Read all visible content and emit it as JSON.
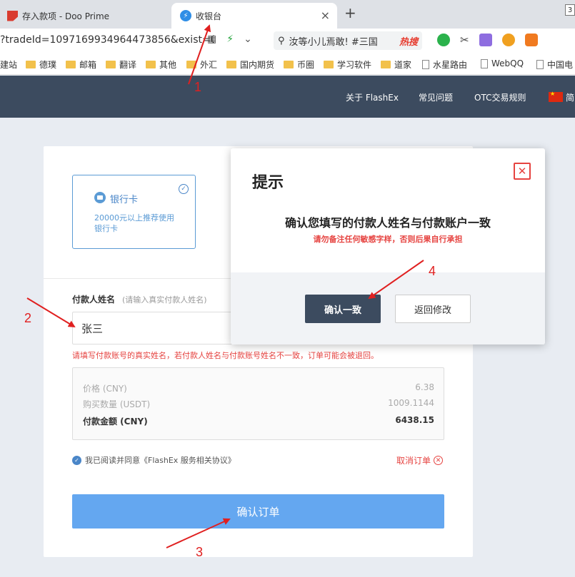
{
  "browser": {
    "tabs": [
      {
        "label": "存入款项 - Doo Prime",
        "active": false
      },
      {
        "label": "收银台",
        "active": true
      }
    ],
    "new_tab": "+",
    "close_tab": "×",
    "window_btn": "3",
    "url": "?tradeId=1097169934964473856&exist=0",
    "search_text": "汝等小儿焉敢! #三国",
    "search_badge": "热搜",
    "bookmarks": [
      "建站",
      "德璞",
      "邮箱",
      "翻译",
      "其他",
      "外汇",
      "国内期货",
      "币圈",
      "学习软件",
      "道家",
      "水星路由",
      "WebQQ",
      "中国电"
    ]
  },
  "header": {
    "nav": [
      "关于 FlashEx",
      "常见问题",
      "OTC交易规则",
      "简"
    ]
  },
  "payment": {
    "bank_card_title": "银行卡",
    "bank_card_desc": "20000元以上推荐使用银行卡",
    "payer_label": "付款人姓名",
    "payer_hint": "(请输入真实付款人姓名)",
    "payer_name": "张三",
    "warning": "请填写付款账号的真实姓名，若付款人姓名与付款账号姓名不一致，订单可能会被退回。",
    "price_label": "价格 (CNY)",
    "price_value": "6.38",
    "qty_label": "购买数量 (USDT)",
    "qty_value": "1009.1144",
    "amount_label": "付款金额 (CNY)",
    "amount_value": "6438.15",
    "agree_text": "我已阅读并同意《FlashEx 服务相关协议》",
    "cancel_text": "取消订单",
    "confirm_button": "确认订单"
  },
  "dialog": {
    "title": "提示",
    "message": "确认您填写的付款人姓名与付款账户一致",
    "sub_message": "请勿备注任何敏感字样，否则后果自行承担",
    "ok_button": "确认一致",
    "back_button": "返回修改"
  },
  "annotations": [
    "1",
    "2",
    "3",
    "4"
  ],
  "colors": {
    "header_bg": "#3c4b5f",
    "accent_blue": "#64a7f0",
    "warning_red": "#e64340",
    "annotation_red": "#e02020"
  }
}
